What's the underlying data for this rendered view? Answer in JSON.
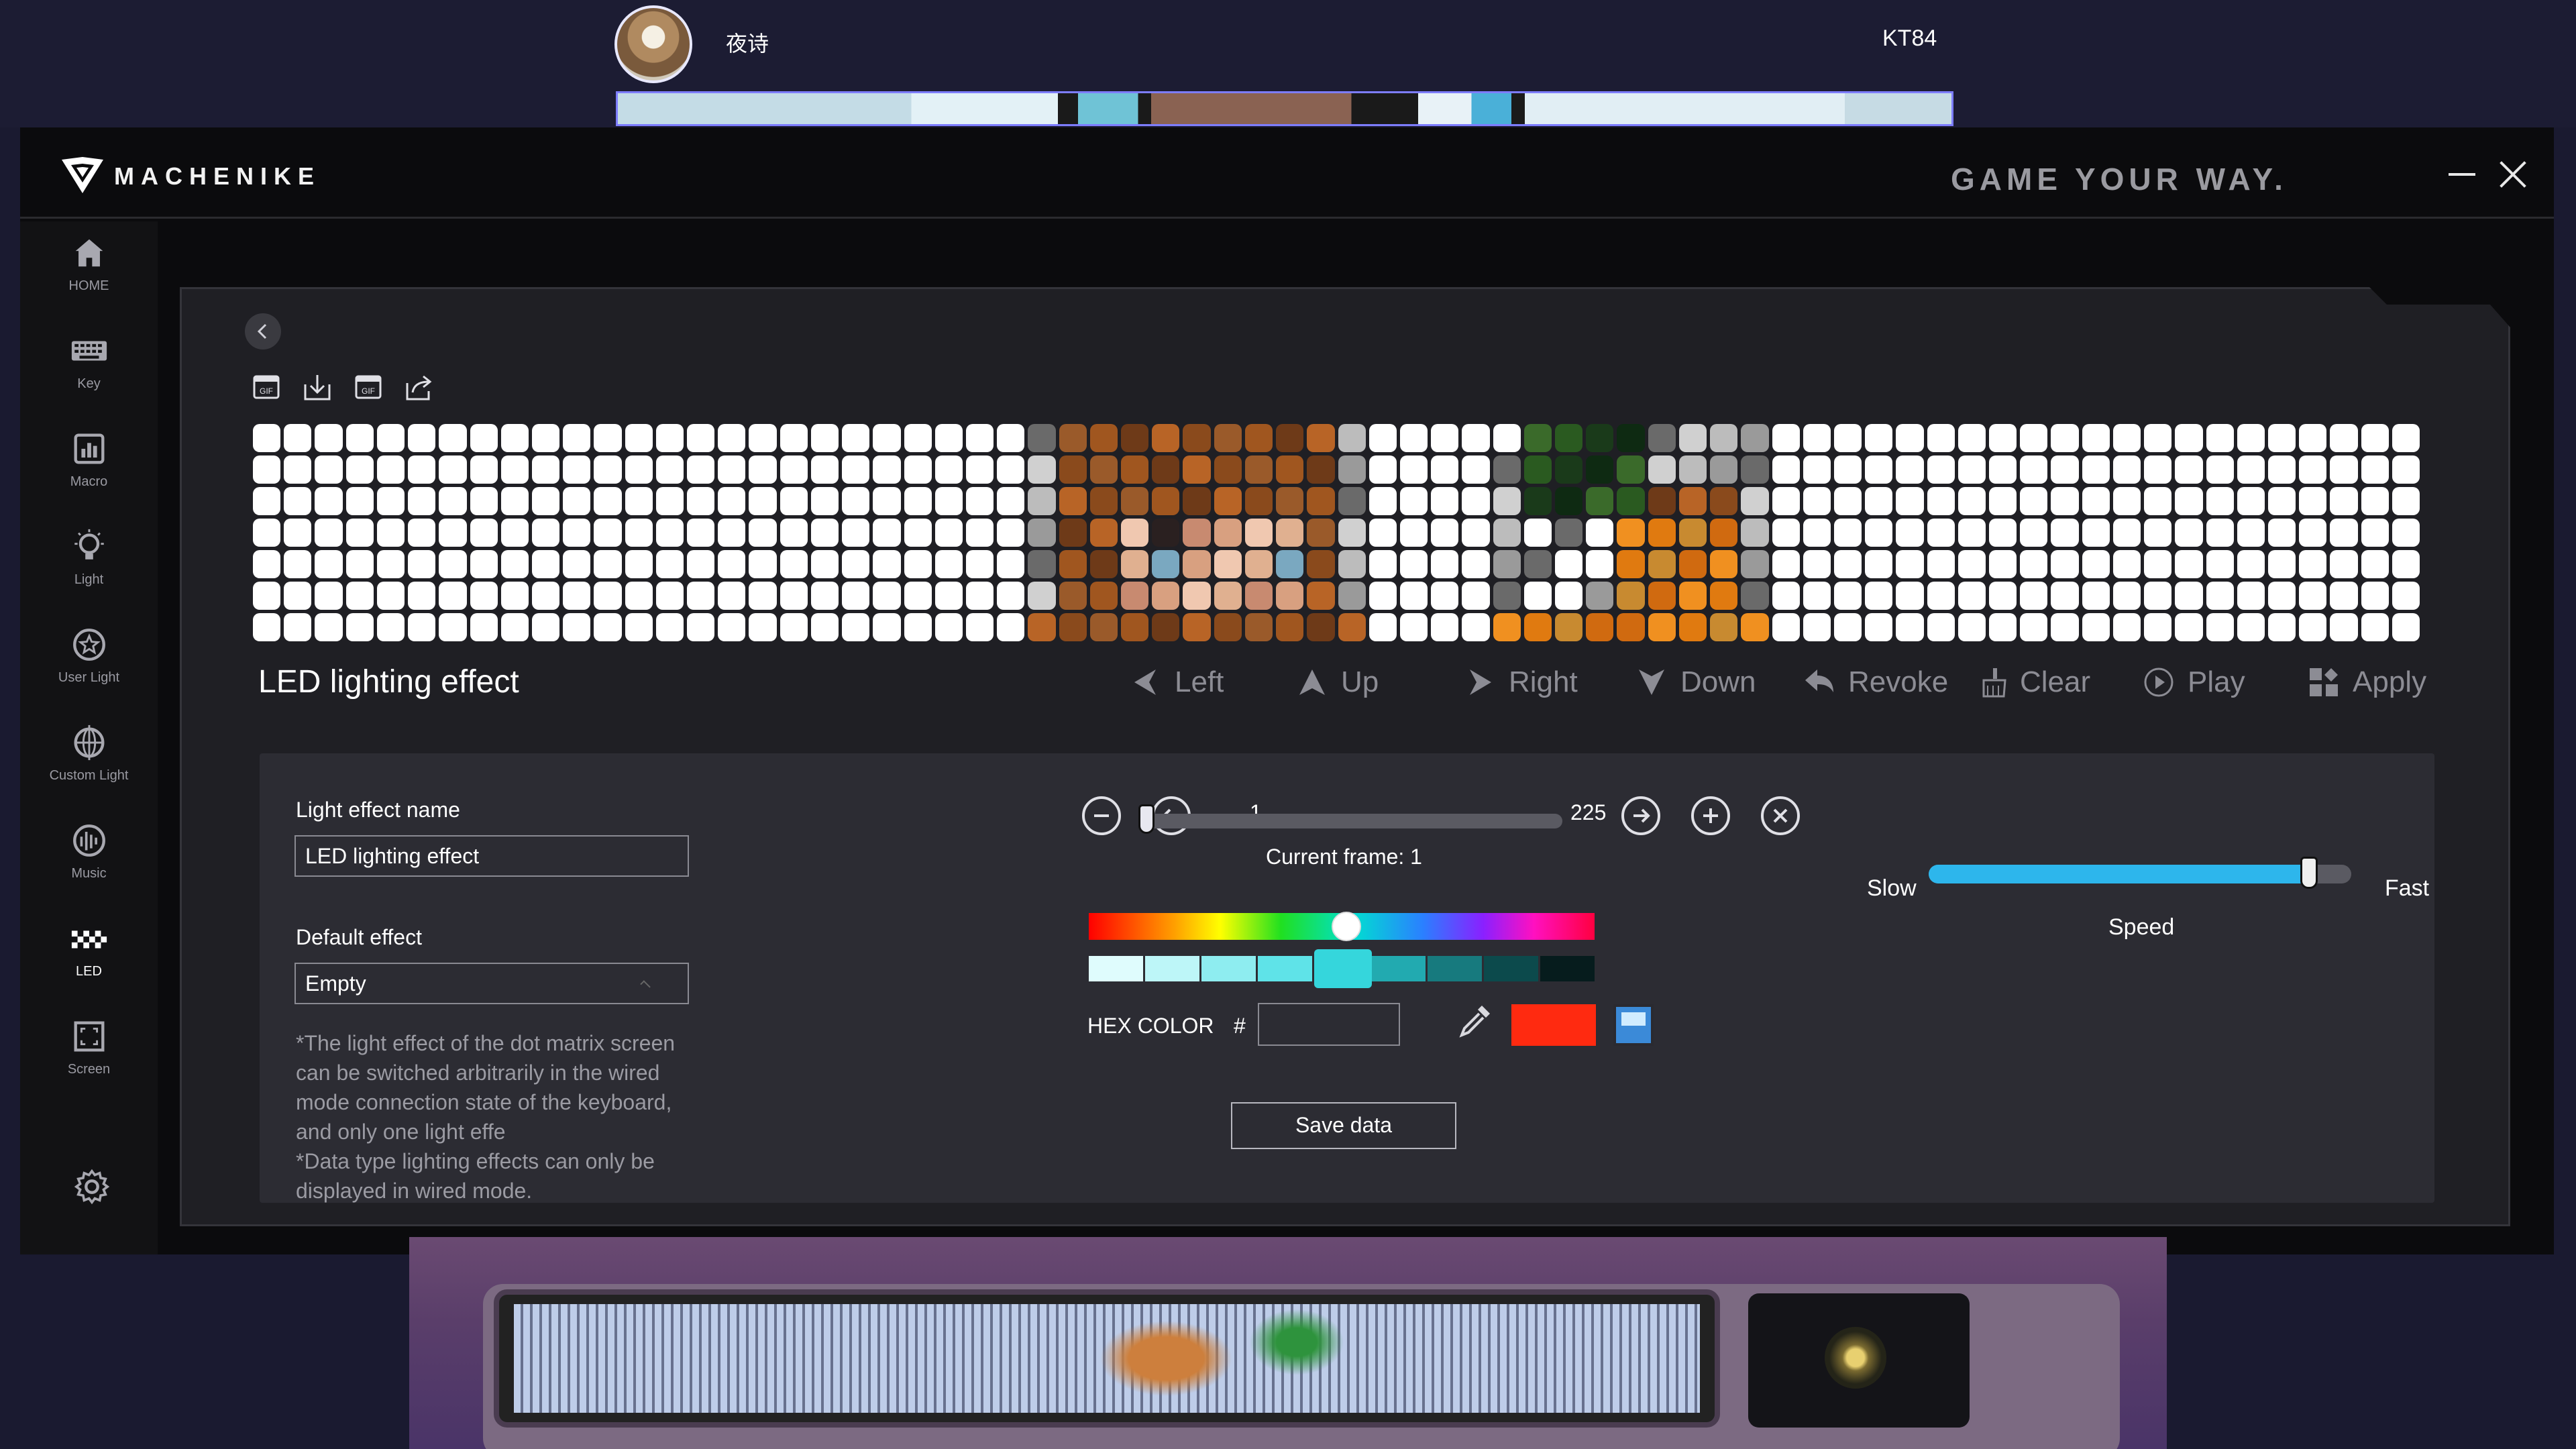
{
  "stream": {
    "username": "夜诗",
    "device": "KT84"
  },
  "app": {
    "brand": "MACHENIKE",
    "tagline": "GAME YOUR WAY."
  },
  "sidebar": {
    "items": [
      {
        "label": "HOME",
        "icon": "home-icon"
      },
      {
        "label": "Key",
        "icon": "keyboard-icon"
      },
      {
        "label": "Macro",
        "icon": "macro-icon"
      },
      {
        "label": "Light",
        "icon": "bulb-icon"
      },
      {
        "label": "User Light",
        "icon": "star-circle-icon"
      },
      {
        "label": "Custom Light",
        "icon": "globe-icon"
      },
      {
        "label": "Music",
        "icon": "music-wave-icon"
      },
      {
        "label": "LED",
        "icon": "led-grid-icon",
        "active": true
      },
      {
        "label": "Screen",
        "icon": "screen-frame-icon"
      }
    ],
    "settings_icon": "gear-icon"
  },
  "editor": {
    "toolbar_icons": [
      "gif-import-icon",
      "download-icon",
      "gif-export-icon",
      "share-icon"
    ],
    "section_title": "LED lighting effect",
    "actions": {
      "left": "Left",
      "up": "Up",
      "right": "Right",
      "down": "Down",
      "revoke": "Revoke",
      "clear": "Clear",
      "play": "Play",
      "apply": "Apply"
    }
  },
  "settings": {
    "name_label": "Light effect name",
    "name_value": "LED lighting effect",
    "default_label": "Default effect",
    "default_value": "Empty",
    "note_1": "*The light effect of the dot matrix screen can be switched arbitrarily in the wired mode connection state of the keyboard, and only one light effe",
    "note_2": "*Data type lighting effects can only be displayed in wired mode.",
    "frame_min": "1",
    "frame_max": "225",
    "current_frame": "Current frame: 1",
    "hex_label": "HEX COLOR",
    "hex_hash": "#",
    "hex_value": "",
    "current_color": "#ff2a10",
    "save_label": "Save data",
    "speed_slow": "Slow",
    "speed_fast": "Fast",
    "speed_label": "Speed",
    "speed_level": 0.9,
    "frame_position": 0
  }
}
